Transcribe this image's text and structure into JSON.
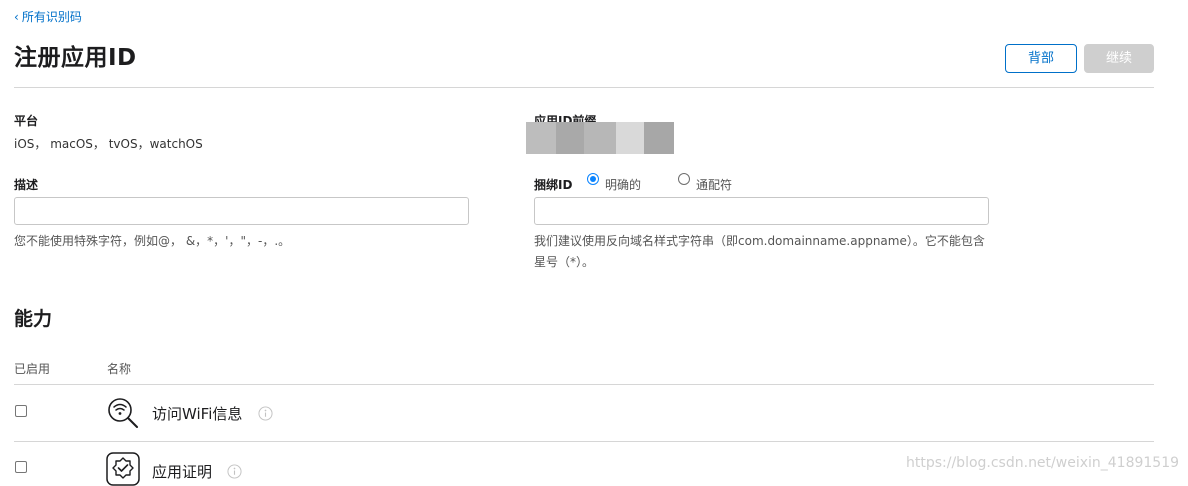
{
  "nav": {
    "back_link": "所有识别码"
  },
  "header": {
    "title": "注册应用ID",
    "back_button": "背部",
    "continue_button": "继续"
  },
  "platform": {
    "label": "平台",
    "value": "iOS， macOS， tvOS，watchOS"
  },
  "prefix": {
    "label": "应用ID前缀"
  },
  "description": {
    "label": "描述",
    "value": "",
    "hint": "您不能使用特殊字符，例如@， &，*，'，\"，-，.。"
  },
  "bundle": {
    "label": "捆绑ID",
    "options": [
      {
        "label": "明确的",
        "selected": true
      },
      {
        "label": "通配符",
        "selected": false
      }
    ],
    "value": "",
    "hint": "我们建议使用反向域名样式字符串（即com.domainname.appname）。它不能包含星号（*）。"
  },
  "capabilities": {
    "title": "能力",
    "col_enabled": "已启用",
    "col_name": "名称",
    "rows": [
      {
        "name": "访问WiFi信息",
        "icon": "wifi-search-icon",
        "enabled": false
      },
      {
        "name": "应用证明",
        "icon": "badge-check-icon",
        "enabled": false
      }
    ]
  },
  "watermark": "https://blog.csdn.net/weixin_41891519",
  "colors": {
    "accent": "#0070c9",
    "disabled": "#cfcfcf",
    "divider": "#d6d6d6"
  }
}
